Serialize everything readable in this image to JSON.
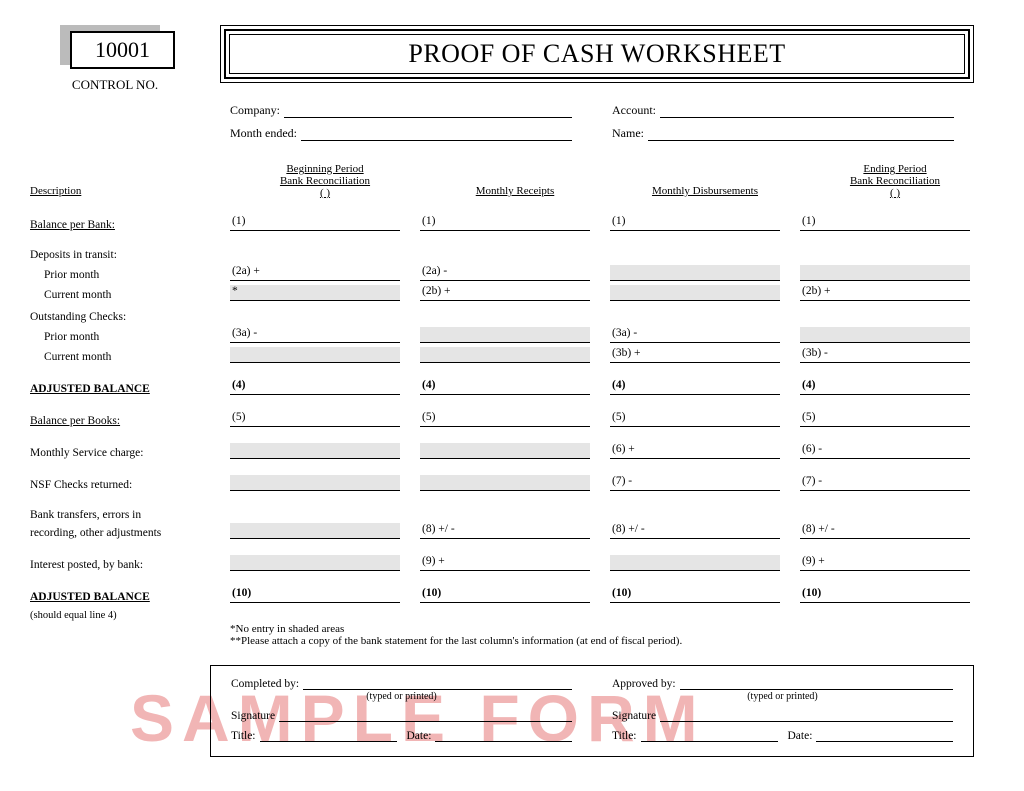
{
  "control": {
    "number": "10001",
    "label": "CONTROL NO."
  },
  "title": "PROOF OF CASH WORKSHEET",
  "header": {
    "company_label": "Company:",
    "account_label": "Account:",
    "month_label": "Month ended:",
    "name_label": "Name:"
  },
  "columns": {
    "description": "Description",
    "col1_l1": "Beginning Period",
    "col1_l2": "Bank Reconciliation",
    "col1_l3": "(                    )",
    "col2": "Monthly Receipts",
    "col3": "Monthly Disbursements",
    "col4_l1": "Ending Period",
    "col4_l2": "Bank Reconciliation",
    "col4_l3": "(                  )"
  },
  "rows": {
    "balance_bank": "Balance per Bank:",
    "deposits": "Deposits in transit:",
    "prior_month": "Prior month",
    "current_month": "Current month",
    "outstanding": "Outstanding Checks:",
    "adj_balance": "ADJUSTED BALANCE",
    "balance_books": "Balance per Books:",
    "service_charge": "Monthly Service charge:",
    "nsf": "NSF Checks returned:",
    "transfers_l1": "Bank transfers, errors in",
    "transfers_l2": "recording, other adjustments",
    "interest": "Interest posted, by bank:",
    "should_equal": "(should equal  line 4)",
    "m1": "(1)",
    "m2a_plus": "(2a)  +",
    "m2a_minus": "(2a)  -",
    "m2b_plus": "(2b)  +",
    "m_star": "*",
    "m3a_minus": "(3a)  -",
    "m3a_minus2": "(3a)   -",
    "m3b_plus": "(3b)   +",
    "m3b_minus": "(3b)  -",
    "m4": "(4)",
    "m5": "(5)",
    "m6_plus": "(6)   +",
    "m6_minus": "(6)   -",
    "m7_minus": "(7)   -",
    "m7_minus2": "(7)   -",
    "m8": "(8) +/ -",
    "m8b": "(8)  +/ -",
    "m9_plus": "(9) +",
    "m9_plus2": "(9)  +",
    "m10": "(10)"
  },
  "footnotes": {
    "f1": "*No entry in shaded areas",
    "f2": "**Please attach a copy of the bank statement for the last column's information (at end of fiscal period)."
  },
  "sig": {
    "completed": "Completed by:",
    "approved": "Approved by:",
    "typed": "(typed or  printed)",
    "signature": "Signature",
    "title": "Title:",
    "date": "Date:"
  },
  "watermark": "SAMPLE  FORM"
}
